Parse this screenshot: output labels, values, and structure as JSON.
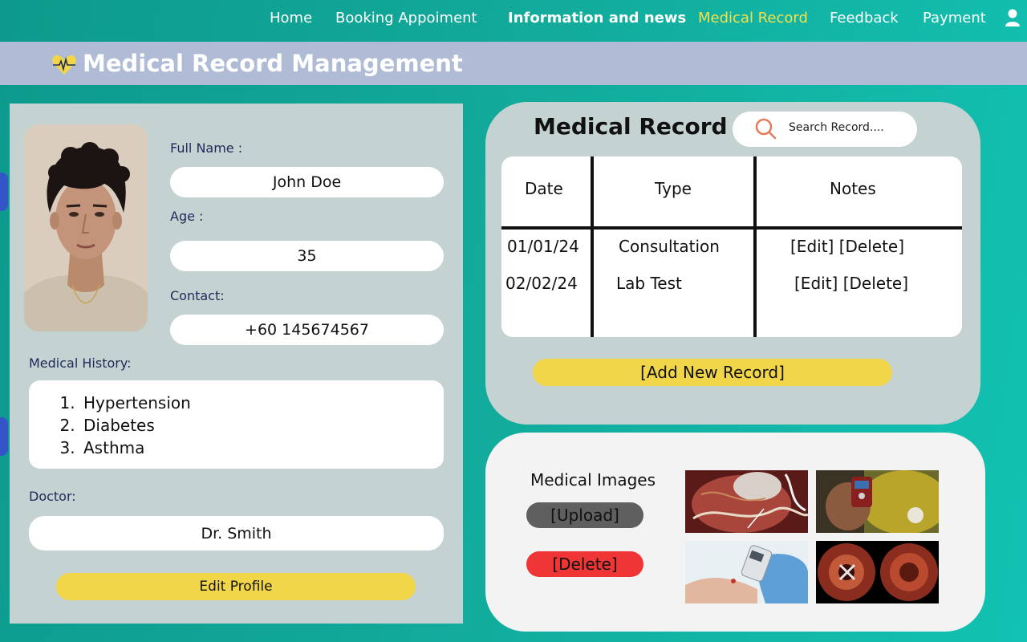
{
  "nav": {
    "items": [
      {
        "label": "Home"
      },
      {
        "label": "Booking Appoiment"
      },
      {
        "label": "Information and news"
      },
      {
        "label": "Medical Record"
      },
      {
        "label": "Feedback"
      },
      {
        "label": "Payment"
      }
    ],
    "active_color": "#f2e14a"
  },
  "header": {
    "title": "Medical Record Management",
    "band_color": "#b0bcd6"
  },
  "profile": {
    "full_name_label": "Full Name  :",
    "full_name": "John Doe",
    "age_label": "Age  :",
    "age": "35",
    "contact_label": "Contact:",
    "contact": "+60 145674567",
    "history_label": "Medical History:",
    "history": [
      "Hypertension",
      "Diabetes",
      "Asthma"
    ],
    "doctor_label": "Doctor:",
    "doctor": "Dr. Smith",
    "edit_button": "Edit Profile"
  },
  "record": {
    "title": "Medical Record",
    "search_placeholder": "Search Record....",
    "columns": [
      "Date",
      "Type",
      "Notes"
    ],
    "rows": [
      {
        "date": "01/01/24",
        "type": "Consultation",
        "notes": "[Edit] [Delete]"
      },
      {
        "date": "02/02/24",
        "type": "Lab Test",
        "notes": "[Edit] [Delete]"
      }
    ],
    "add_button": "[Add New Record]"
  },
  "images": {
    "label": "Medical Images",
    "upload_button": "[Upload]",
    "delete_button": "[Delete]"
  },
  "colors": {
    "accent_yellow": "#f1d649",
    "delete_red": "#ef3535",
    "panel_gray": "#c4d2d1",
    "background_teal": "#12ab9c"
  }
}
